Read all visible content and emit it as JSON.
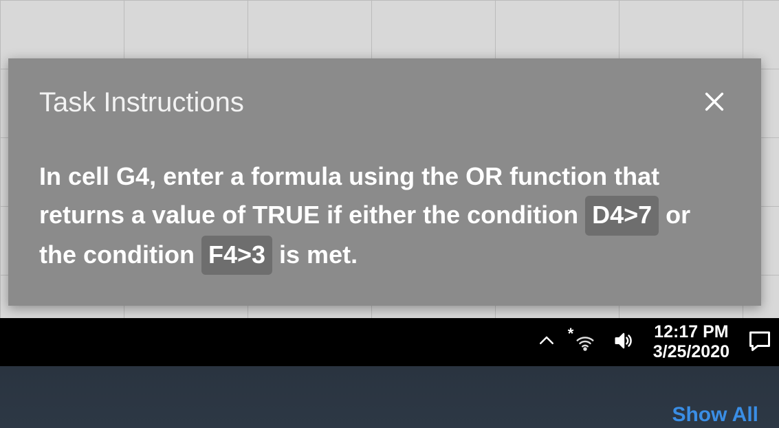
{
  "dialog": {
    "title": "Task Instructions",
    "body": {
      "part1": "In cell G4, enter a formula using the OR function that returns a value of TRUE if either the condition ",
      "code1": "D4>7",
      "part2": " or the condition ",
      "code2": "F4>3",
      "part3": " is met."
    }
  },
  "taskbar": {
    "time": "12:17 PM",
    "date": "3/25/2020"
  },
  "bottom": {
    "show_all": "Show All"
  }
}
